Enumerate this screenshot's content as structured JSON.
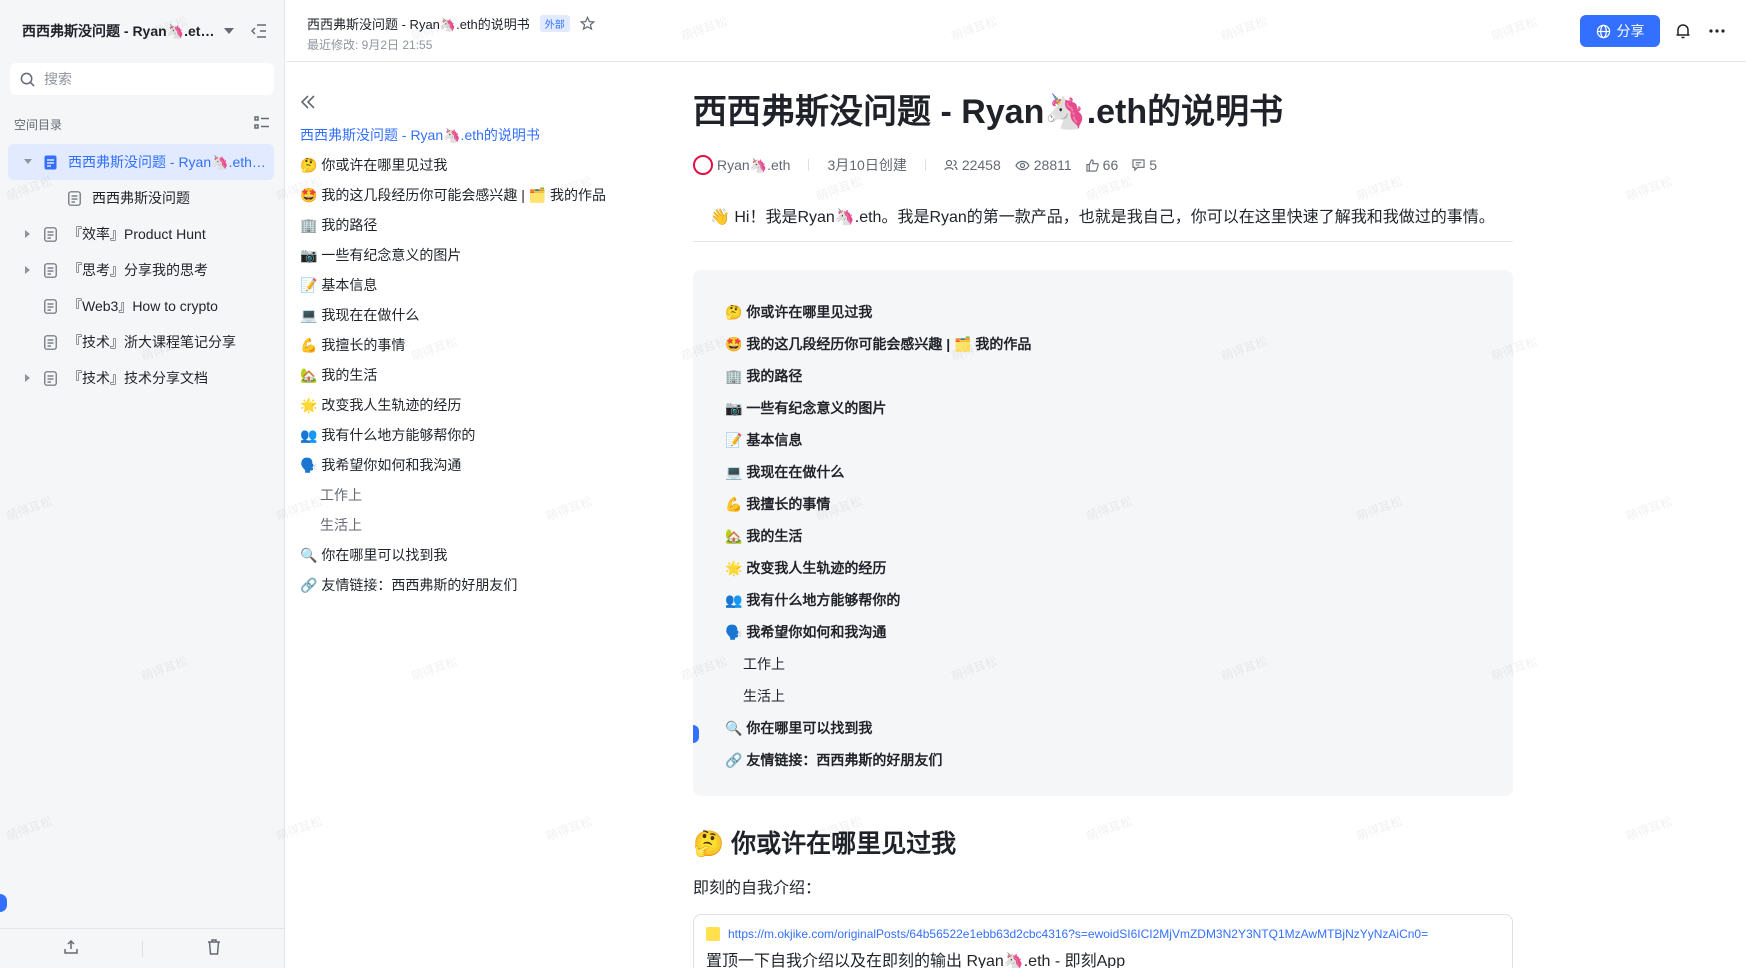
{
  "sidebar": {
    "space_title": "西西弗斯没问题 - Ryan🦄.eth的说明书",
    "search_placeholder": "搜索",
    "tree_header": "空间目录",
    "items": [
      {
        "label": "西西弗斯没问题 - Ryan🦄.eth的说明书",
        "active": true,
        "expandable": true,
        "level": 0
      },
      {
        "label": "西西弗斯没问题",
        "active": false,
        "expandable": false,
        "level": 1
      },
      {
        "label": "『效率』Product Hunt",
        "active": false,
        "expandable": true,
        "level": 0
      },
      {
        "label": "『思考』分享我的思考",
        "active": false,
        "expandable": true,
        "level": 0
      },
      {
        "label": "『Web3』How to crypto",
        "active": false,
        "expandable": false,
        "level": 0
      },
      {
        "label": "『技术』浙大课程笔记分享",
        "active": false,
        "expandable": false,
        "level": 0
      },
      {
        "label": "『技术』技术分享文档",
        "active": false,
        "expandable": true,
        "level": 0
      }
    ]
  },
  "topbar": {
    "doc_title": "西西弗斯没问题 - Ryan🦄.eth的说明书",
    "tag": "外部",
    "last_modified": "最近修改: 9月2日 21:55",
    "share_label": "分享"
  },
  "outline": {
    "title": "西西弗斯没问题 - Ryan🦄.eth的说明书",
    "items": [
      {
        "label": "🤔 你或许在哪里见过我",
        "sub": false
      },
      {
        "label": "🤩 我的这几段经历你可能会感兴趣 | 🗂️ 我的作品",
        "sub": false
      },
      {
        "label": "🏢 我的路径",
        "sub": false
      },
      {
        "label": "📷 一些有纪念意义的图片",
        "sub": false
      },
      {
        "label": "📝 基本信息",
        "sub": false
      },
      {
        "label": "💻 我现在在做什么",
        "sub": false
      },
      {
        "label": "💪 我擅长的事情",
        "sub": false
      },
      {
        "label": "🏡 我的生活",
        "sub": false
      },
      {
        "label": "🌟 改变我人生轨迹的经历",
        "sub": false
      },
      {
        "label": "👥 我有什么地方能够帮你的",
        "sub": false
      },
      {
        "label": "🗣️ 我希望你如何和我沟通",
        "sub": false
      },
      {
        "label": "工作上",
        "sub": true
      },
      {
        "label": "生活上",
        "sub": true
      },
      {
        "label": "🔍 你在哪里可以找到我",
        "sub": false
      },
      {
        "label": "🔗 友情链接：西西弗斯的好朋友们",
        "sub": false
      }
    ]
  },
  "doc": {
    "title": "西西弗斯没问题 - Ryan🦄.eth的说明书",
    "author": "Ryan🦄.eth",
    "created": "3月10日创建",
    "stats": {
      "readers": "22458",
      "views": "28811",
      "likes": "66",
      "comments": "5"
    },
    "intro": "👋 Hi！我是Ryan🦄.eth。我是Ryan的第一款产品，也就是我自己，你可以在这里快速了解我和我做过的事情。",
    "toc": [
      {
        "label": "🤔 你或许在哪里见过我",
        "sub": false
      },
      {
        "label": "🤩 我的这几段经历你可能会感兴趣 | 🗂️ 我的作品",
        "sub": false
      },
      {
        "label": "🏢 我的路径",
        "sub": false
      },
      {
        "label": "📷 一些有纪念意义的图片",
        "sub": false
      },
      {
        "label": "📝 基本信息",
        "sub": false
      },
      {
        "label": "💻 我现在在做什么",
        "sub": false
      },
      {
        "label": "💪 我擅长的事情",
        "sub": false
      },
      {
        "label": "🏡 我的生活",
        "sub": false
      },
      {
        "label": "🌟 改变我人生轨迹的经历",
        "sub": false
      },
      {
        "label": "👥 我有什么地方能够帮你的",
        "sub": false
      },
      {
        "label": "🗣️ 我希望你如何和我沟通",
        "sub": false
      },
      {
        "label": "工作上",
        "sub": true
      },
      {
        "label": "生活上",
        "sub": true
      },
      {
        "label": "🔍 你在哪里可以找到我",
        "sub": false
      },
      {
        "label": "🔗 友情链接：西西弗斯的好朋友们",
        "sub": false
      }
    ],
    "section_heading": "🤔 你或许在哪里见过我",
    "section_para": "即刻的自我介绍：",
    "link_card": {
      "url": "https://m.okjike.com/originalPosts/64b56522e1ebb63d2cbc4316?s=ewoidSI6ICI2MjVmZDM3N2Y3NTQ1MzAwMTBjNzYyNzAiCn0=",
      "title": "置顶一下自我介绍以及在即刻的输出 Ryan🦄.eth - 即刻App"
    }
  },
  "watermark": "萌得耳松",
  "colors": {
    "accent": "#3370ff",
    "sidebar_bg": "#f5f6f7",
    "toc_bg": "#f5f6f7"
  }
}
